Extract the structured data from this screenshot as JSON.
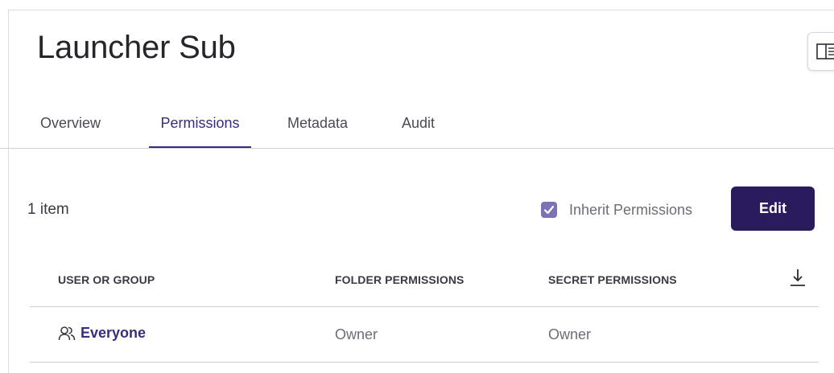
{
  "header": {
    "title": "Launcher Sub",
    "panel_toggle_icon": "side-panel-icon"
  },
  "tabs": [
    {
      "label": "Overview",
      "active": false
    },
    {
      "label": "Permissions",
      "active": true
    },
    {
      "label": "Metadata",
      "active": false
    },
    {
      "label": "Audit",
      "active": false
    }
  ],
  "toolbar": {
    "count_label": "1 item",
    "inherit_label": "Inherit Permissions",
    "inherit_checked": true,
    "edit_label": "Edit"
  },
  "table": {
    "columns": [
      "USER OR GROUP",
      "FOLDER PERMISSIONS",
      "SECRET PERMISSIONS"
    ],
    "download_icon": "download-icon",
    "rows": [
      {
        "principal": "Everyone",
        "principal_icon": "group-icon",
        "folder": "Owner",
        "secret": "Owner"
      }
    ]
  },
  "colors": {
    "accent": "#2a1b5e",
    "tab_underline": "#3b2a7f",
    "checkbox": "#7d73b4",
    "link": "#3b2d7d"
  }
}
